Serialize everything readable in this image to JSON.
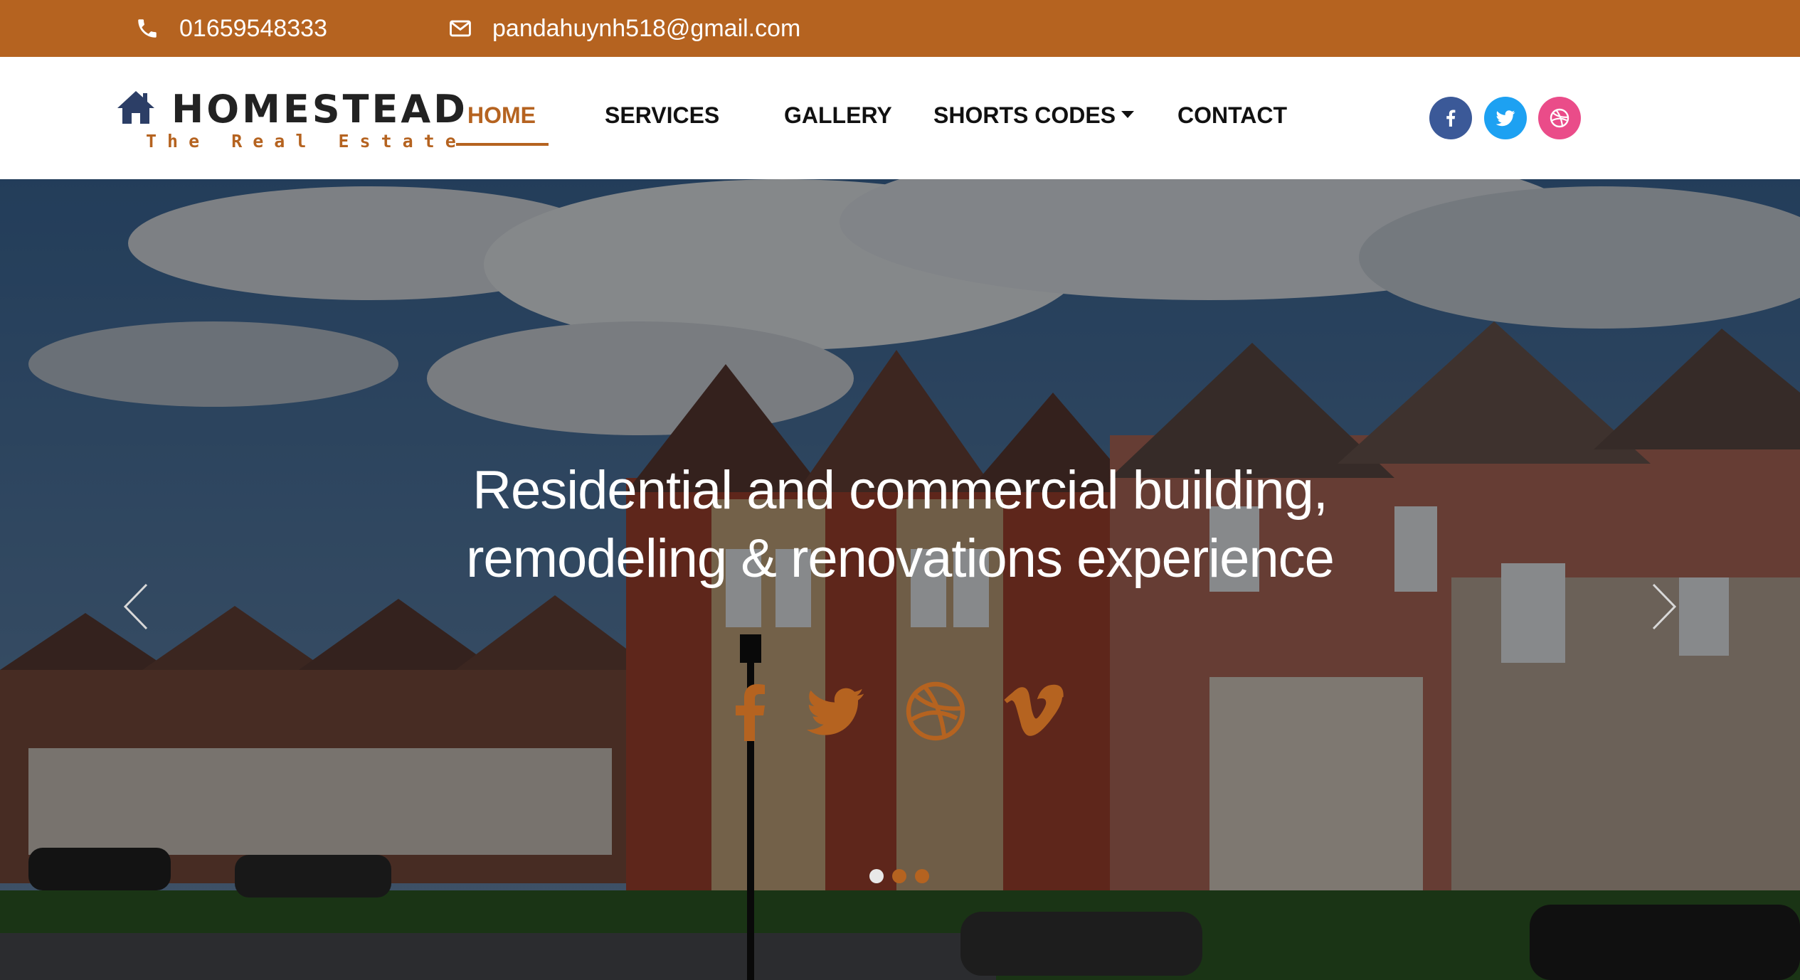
{
  "topbar": {
    "phone": "01659548333",
    "email": "pandahuynh518@gmail.com",
    "phone_icon": "phone-icon",
    "email_icon": "envelope-icon",
    "background": "#b56320"
  },
  "brand": {
    "name": "HOMESTEAD",
    "tagline": "The Real Estate",
    "icon": "house-icon",
    "accent": "#b56320"
  },
  "nav": {
    "items": [
      {
        "label": "HOME",
        "active": true
      },
      {
        "label": "SERVICES",
        "active": false
      },
      {
        "label": "GALLERY",
        "active": false
      },
      {
        "label": "SHORTS CODES",
        "active": false,
        "has_dropdown": true
      },
      {
        "label": "CONTACT",
        "active": false
      }
    ],
    "social": [
      {
        "icon": "facebook-icon",
        "color": "#3b5998"
      },
      {
        "icon": "twitter-icon",
        "color": "#1da1f2"
      },
      {
        "icon": "dribbble-icon",
        "color": "#ea4c89"
      }
    ]
  },
  "hero": {
    "headline_line1": "Residential and commercial building,",
    "headline_line2": "remodeling & renovations experience",
    "social": [
      {
        "icon": "facebook-icon"
      },
      {
        "icon": "twitter-icon"
      },
      {
        "icon": "dribbble-icon"
      },
      {
        "icon": "vimeo-icon"
      }
    ],
    "icon_color": "#b56320",
    "slides_total": 3,
    "slide_active": 1
  }
}
